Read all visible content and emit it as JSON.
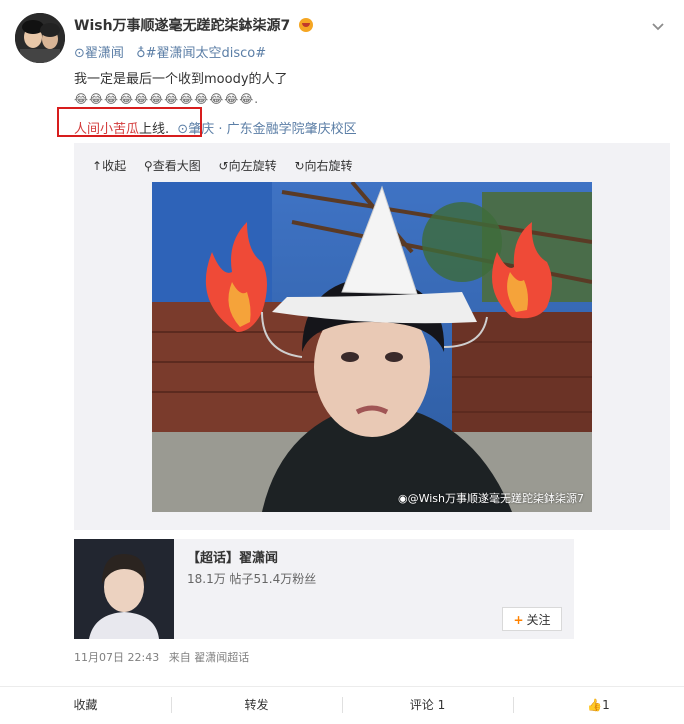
{
  "post": {
    "username": "Wish万事顺遂毫无蹉跎柒鉢柒源7",
    "tags": [
      "翟潇闻",
      "#翟潇闻太空disco#"
    ],
    "line1": "我一定是最后一个收到moody的人了",
    "emojis": "😂😂😂😂😂😂😂😂😂😂😂😂.",
    "red_text": "人间小苦瓜",
    "after_red": "上线.",
    "location": "肇庆 · 广东金融学院肇庆校区"
  },
  "toolbar": {
    "collapse": "收起",
    "view_large": "查看大图",
    "rotate_left": "向左旋转",
    "rotate_right": "向右旋转"
  },
  "photo": {
    "watermark": "@Wish万事顺遂毫无蹉跎柒鉢柒源7"
  },
  "topic": {
    "title": "【超话】翟潇闻",
    "stats": "18.1万 帖子51.4万粉丝",
    "follow_label": "关注"
  },
  "meta": {
    "time": "11月07日 22:43",
    "source": "来自 翟潇闻超话"
  },
  "actions": {
    "favorite": "收藏",
    "repost": "转发",
    "comment": "评论 1",
    "like_count": "1"
  },
  "colors": {
    "link_blue": "#5b7ea6",
    "highlight_red": "#d71d1d",
    "follow_plus": "#ff8200"
  }
}
